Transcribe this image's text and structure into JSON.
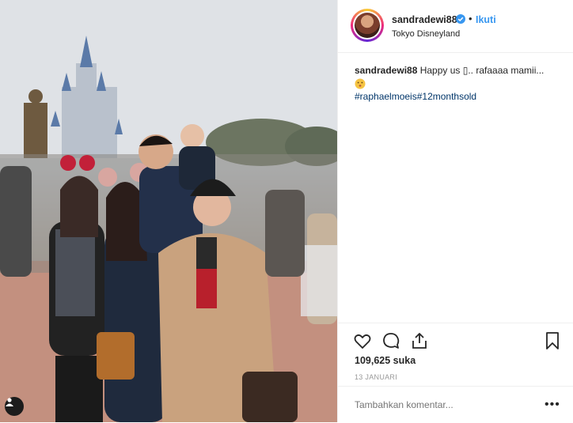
{
  "post": {
    "username": "sandradewi88",
    "follow_label": "Ikuti",
    "dot": "•",
    "location": "Tokyo Disneyland",
    "caption_user": "sandradewi88",
    "caption_text": "Happy us ▯.. rafaaaa mamii...",
    "hashtags": "#raphaelmoeis#12monthsold",
    "likes": "109,625 suka",
    "date": "13 JANUARI",
    "comment_placeholder": "Tambahkan komentar...",
    "more_label": "•••"
  },
  "icons": {
    "verified": "verified-badge-icon",
    "like": "heart-icon",
    "comment": "comment-icon",
    "share": "share-icon",
    "save": "bookmark-icon",
    "tagged": "user-tag-icon"
  },
  "colors": {
    "accent": "#3897f0",
    "hashtag": "#003569",
    "text": "#262626",
    "muted": "#999999"
  }
}
